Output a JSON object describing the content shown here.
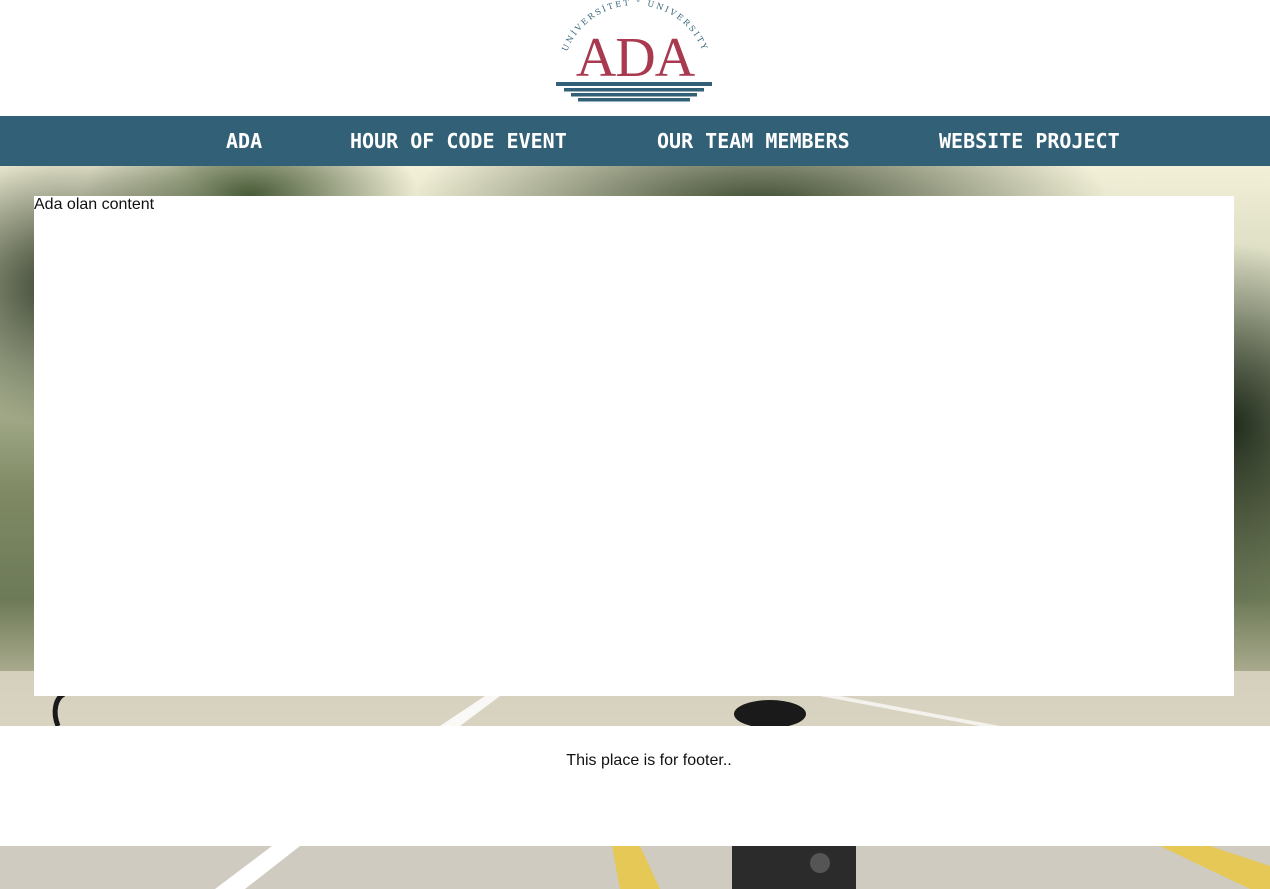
{
  "logo": {
    "name": "ADA",
    "arc_text": "UNİVERSİTET ° UNIVERSITY",
    "colors": {
      "letters": "#a8394f",
      "stripes": "#326177"
    }
  },
  "nav": {
    "background": "#326177",
    "items": [
      {
        "label": "ADA"
      },
      {
        "label": "HOUR OF CODE EVENT"
      },
      {
        "label": "OUR TEAM MEMBERS"
      },
      {
        "label": "WEBSITE PROJECT"
      }
    ]
  },
  "main": {
    "content_text": "Ada olan content"
  },
  "footer": {
    "text": "This place is for footer.."
  }
}
